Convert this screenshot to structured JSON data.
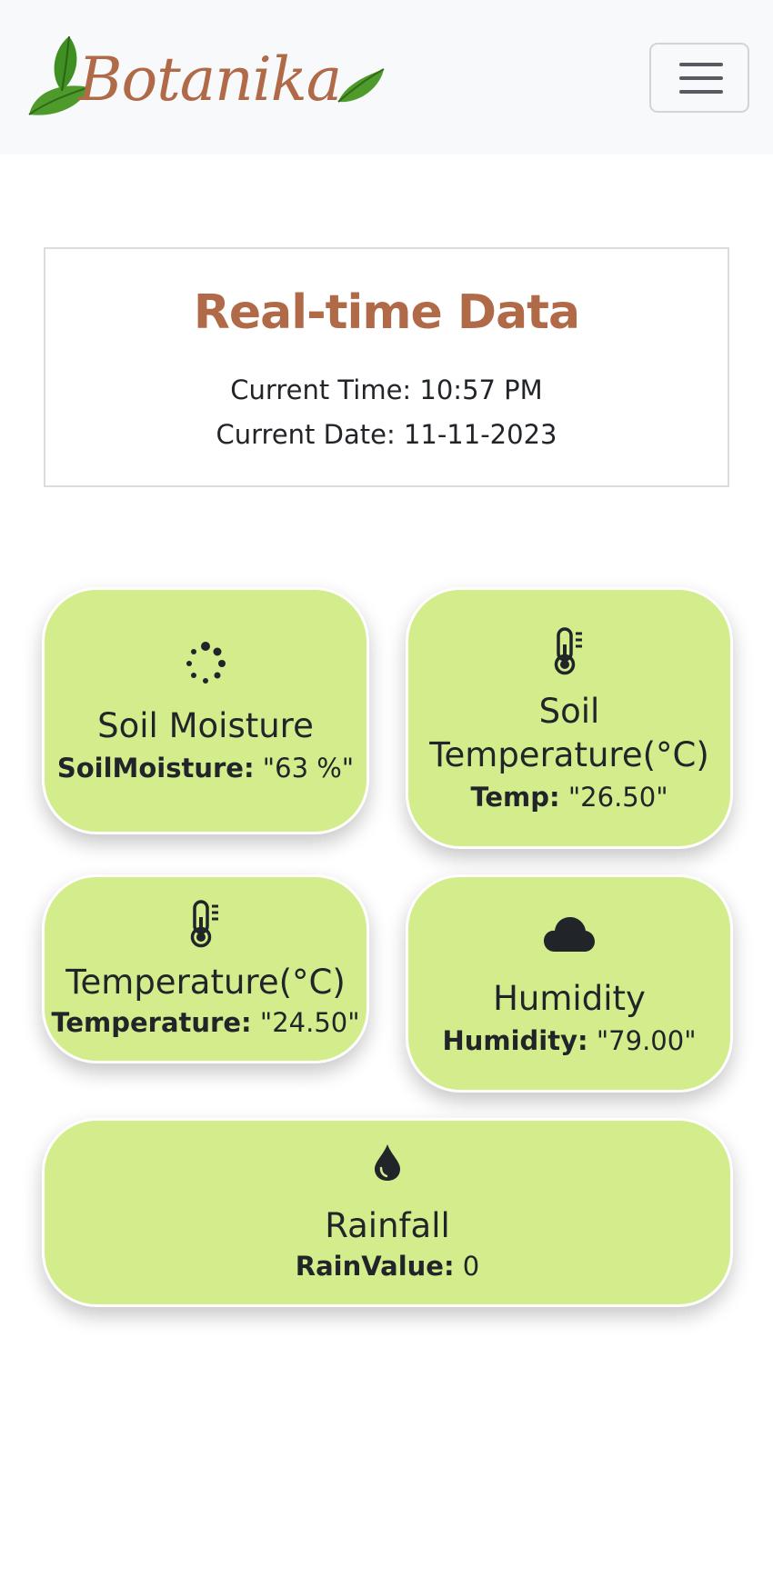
{
  "brand": {
    "name": "Botanika"
  },
  "realtime": {
    "title": "Real-time Data",
    "time_line": "Current Time: 10:57 PM",
    "date_line": "Current Date: 11-11-2023"
  },
  "cards": {
    "soil_moisture": {
      "title": "Soil Moisture",
      "label": "SoilMoisture:",
      "value": "\"63 %\"",
      "icon": "spinner-icon"
    },
    "soil_temperature": {
      "title_line1": "Soil",
      "title_line2": "Temperature(°C)",
      "label": "Temp:",
      "value": "\"26.50\"",
      "icon": "thermometer-icon"
    },
    "temperature": {
      "title": "Temperature(°C)",
      "label": "Temperature:",
      "value": "\"24.50\"",
      "icon": "thermometer-icon"
    },
    "humidity": {
      "title": "Humidity",
      "label": "Humidity:",
      "value": "\"79.00\"",
      "icon": "cloud-icon"
    },
    "rainfall": {
      "title": "Rainfall",
      "label": "RainValue:",
      "value": "0",
      "icon": "droplet-icon"
    }
  },
  "colors": {
    "brand_brown": "#b06a48",
    "card_green": "#d3ec8c",
    "navbar_bg": "#f8f9fa",
    "leaf_green": "#4d9a2a"
  }
}
